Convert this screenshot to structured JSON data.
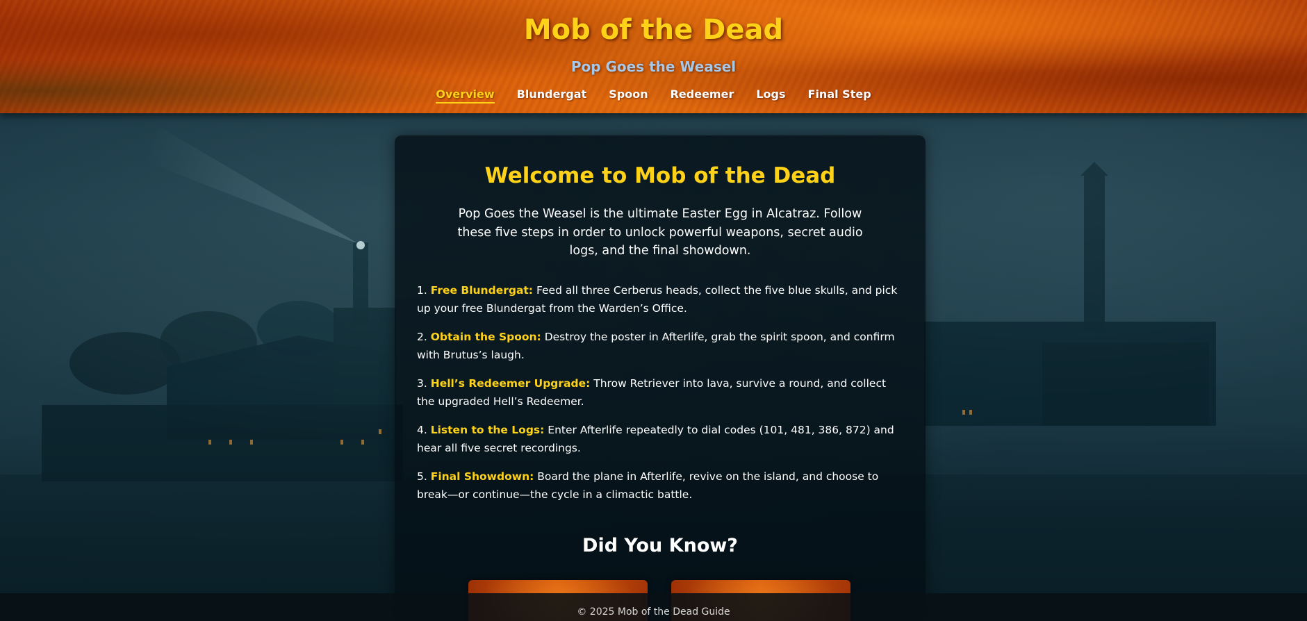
{
  "header": {
    "title": "Mob of the Dead",
    "subtitle": "Pop Goes the Weasel"
  },
  "nav": {
    "items": [
      {
        "label": "Overview",
        "active": true
      },
      {
        "label": "Blundergat",
        "active": false
      },
      {
        "label": "Spoon",
        "active": false
      },
      {
        "label": "Redeemer",
        "active": false
      },
      {
        "label": "Logs",
        "active": false
      },
      {
        "label": "Final Step",
        "active": false
      }
    ]
  },
  "main": {
    "welcome_title": "Welcome to Mob of the Dead",
    "intro": "Pop Goes the Weasel is the ultimate Easter Egg in Alcatraz. Follow these five steps in order to unlock powerful weapons, secret audio logs, and the final showdown.",
    "steps": [
      {
        "number": "1.",
        "title": "Free Blundergat:",
        "text": "Feed all three Cerberus heads, collect the five blue skulls, and pick up your free Blundergat from the Warden’s Office."
      },
      {
        "number": "2.",
        "title": "Obtain the Spoon:",
        "text": "Destroy the poster in Afterlife, grab the spirit spoon, and confirm with Brutus’s laugh."
      },
      {
        "number": "3.",
        "title": "Hell’s Redeemer Upgrade:",
        "text": "Throw Retriever into lava, survive a round, and collect the upgraded Hell’s Redeemer."
      },
      {
        "number": "4.",
        "title": "Listen to the Logs:",
        "text": "Enter Afterlife repeatedly to dial codes (101, 481, 386, 872) and hear all five secret recordings."
      },
      {
        "number": "5.",
        "title": "Final Showdown:",
        "text": "Board the plane in Afterlife, revive on the island, and choose to break—or continue—the cycle in a climactic battle."
      }
    ],
    "did_you_know_title": "Did You Know?"
  },
  "footer": {
    "text": "© 2025 Mob of the Dead Guide"
  },
  "colors": {
    "accent": "#ffd21a",
    "subtitle": "#a9c7e6",
    "header_orange": "#d85a0a",
    "background_teal": "#1c3b49"
  }
}
